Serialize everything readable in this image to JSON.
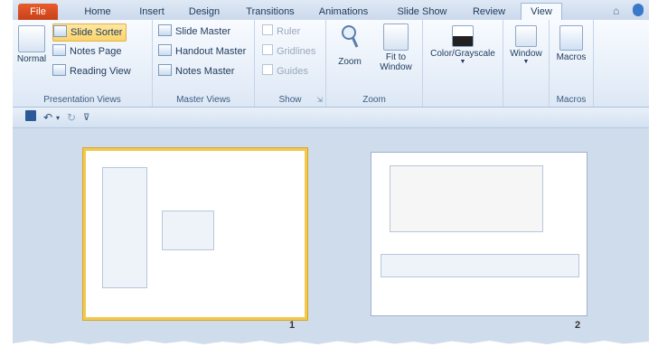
{
  "tabs": [
    {
      "label": "File"
    },
    {
      "label": "Home"
    },
    {
      "label": "Insert"
    },
    {
      "label": "Design"
    },
    {
      "label": "Transitions"
    },
    {
      "label": "Animations"
    },
    {
      "label": "Slide Show"
    },
    {
      "label": "Review"
    },
    {
      "label": "View"
    }
  ],
  "ribbon": {
    "presentation_views": {
      "label": "Presentation Views",
      "normal": "Normal",
      "slide_sorter": "Slide Sorter",
      "notes_page": "Notes Page",
      "reading_view": "Reading View"
    },
    "master_views": {
      "label": "Master Views",
      "slide_master": "Slide Master",
      "handout_master": "Handout Master",
      "notes_master": "Notes Master"
    },
    "show": {
      "label": "Show",
      "ruler": "Ruler",
      "gridlines": "Gridlines",
      "guides": "Guides"
    },
    "zoom": {
      "label": "Zoom",
      "zoom": "Zoom",
      "fit_line1": "Fit to",
      "fit_line2": "Window"
    },
    "color": {
      "label": "Color/Grayscale"
    },
    "window": {
      "label": "Window"
    },
    "macros": {
      "button": "Macros",
      "label": "Macros"
    }
  },
  "slides": [
    {
      "number": "1"
    },
    {
      "number": "2"
    }
  ],
  "colors": {
    "file_tab": "#d0481f",
    "selection": "#fbd36a",
    "slide_border_selected": "#f2c950"
  }
}
